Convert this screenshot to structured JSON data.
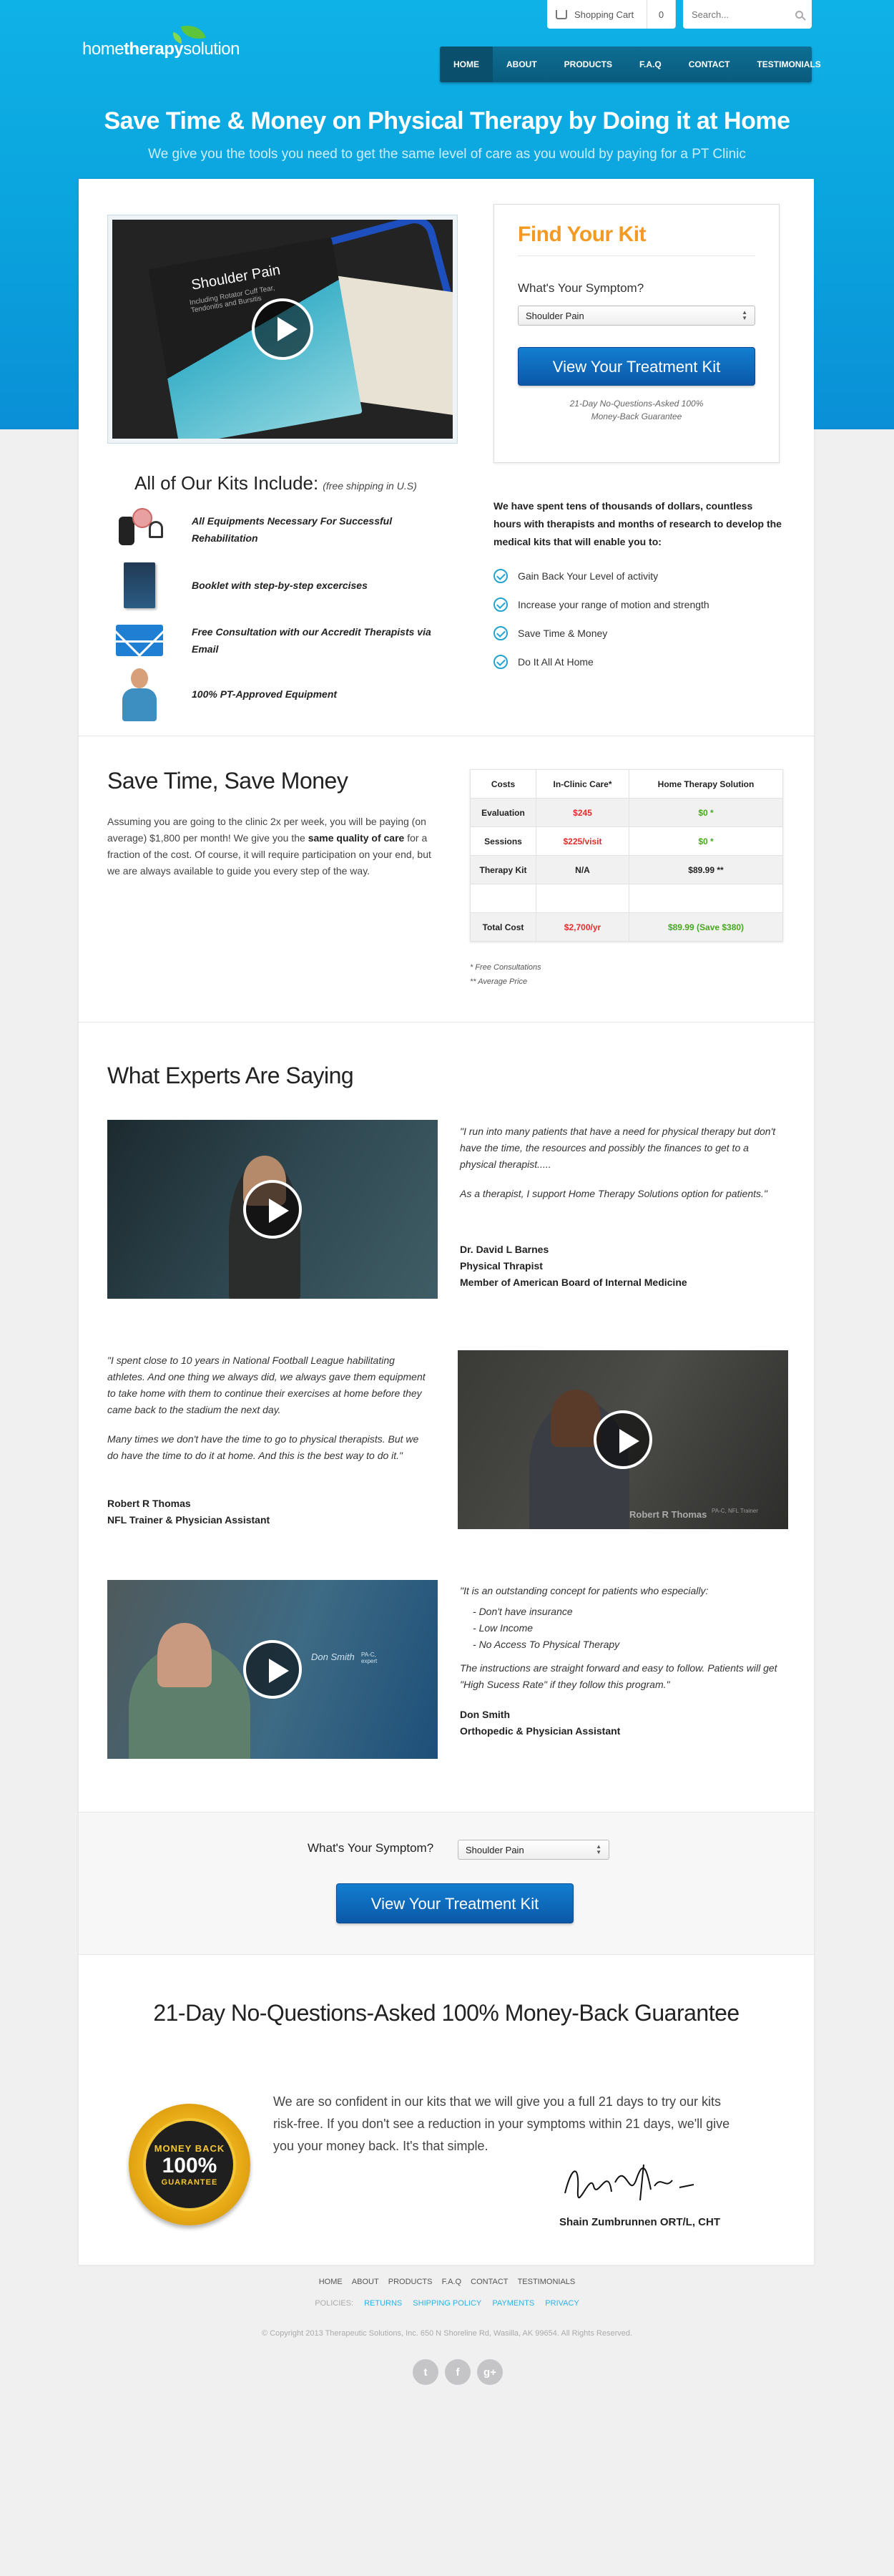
{
  "header": {
    "cart_label": "Shopping Cart",
    "cart_count": "0",
    "search_placeholder": "Search...",
    "logo": {
      "part1": "home",
      "part2": "therapy",
      "part3": "solution"
    },
    "nav": [
      "HOME",
      "ABOUT",
      "PRODUCTS",
      "F.A.Q",
      "CONTACT",
      "TESTIMONIALS"
    ]
  },
  "hero": {
    "title": "Save Time & Money on Physical Therapy by Doing it at Home",
    "subtitle": "We give you the tools you need to get the same level of care as you would by paying for a PT Clinic"
  },
  "product": {
    "folder_title": "Shoulder Pain",
    "folder_sub": "Including Rotator Cuff Tear, Tendonitis and Bursitis",
    "brand": "hometherapysolution"
  },
  "find_kit": {
    "title": "Find Your Kit",
    "symptom_label": "What's Your Symptom?",
    "symptom_value": "Shoulder Pain",
    "button": "View Your Treatment Kit",
    "guarantee": "21-Day No-Questions-Asked 100% Money-Back Guarantee"
  },
  "kits": {
    "title": "All of Our Kits Include:",
    "note": "(free shipping in U.S)",
    "items": [
      {
        "text": "All Equipments Necessary For Successful Rehabilitation",
        "icon": "equipment-icon"
      },
      {
        "text": "Booklet with step-by-step excercises",
        "icon": "booklet-icon"
      },
      {
        "text": "Free Consultation with our Accredit Therapists via Email",
        "icon": "email-icon"
      },
      {
        "text": "100% PT-Approved Equipment",
        "icon": "therapist-icon"
      }
    ]
  },
  "research": {
    "text": "We have spent tens of thousands of dollars, countless hours with therapists and months of research to develop the medical kits that will enable you to:",
    "benefits": [
      "Gain Back Your Level of activity",
      "Increase your range of motion and strength",
      "Save Time & Money",
      "Do It All At Home"
    ]
  },
  "savings": {
    "title": "Save Time, Save Money",
    "p1": "Assuming you are going to the clinic 2x per week, you will be paying (on average) $1,800 per month! We give you the ",
    "p_bold": "same quality of care",
    "p2": " for a fraction of the cost. Of course, it will require participation on your end, but we are always available to guide you every step of the way.",
    "table": {
      "headers": [
        "Costs",
        "In-Clinic Care*",
        "Home Therapy Solution"
      ],
      "rows": [
        [
          "Evaluation",
          "$245",
          "$0 *"
        ],
        [
          "Sessions",
          "$225/visit",
          "$0 *"
        ],
        [
          "Therapy Kit",
          "N/A",
          "$89.99 **"
        ],
        [
          "",
          "",
          ""
        ],
        [
          "Total Cost",
          "$2,700/yr",
          "$89.99 (Save $380)"
        ]
      ]
    },
    "note1": "* Free Consultations",
    "note2": "** Average Price"
  },
  "experts": {
    "title": "What Experts Are Saying",
    "e1": {
      "q1": "\"I run into many patients that have a need for physical therapy but don't have the time, the resources and possibly the finances to get to a physical therapist.....",
      "q2": "As a therapist, I support Home Therapy Solutions option for patients.\"",
      "name": "Dr. David L Barnes",
      "role1": "Physical Thrapist",
      "role2": "Member of American Board of Internal Medicine"
    },
    "e2": {
      "q1": "\"I spent close to 10 years in National Football League habilitating athletes. And one thing we always did, we always gave them equipment to take home with them to continue their exercises at home before they came back to the stadium the next day.",
      "q2": "Many times we don't have the time to go to physical therapists. But we do have the time to do it at home. And this is the best way to do it.\"",
      "name": "Robert R Thomas",
      "role1": "NFL Trainer & Physician Assistant",
      "caption": "Robert R Thomas",
      "caption2": "PA-C, NFL Trainer"
    },
    "e3": {
      "q1": "\"It is an outstanding concept for patients who especially:",
      "bullets": [
        "Don't have insurance",
        "Low Income",
        "No Access To Physical Therapy"
      ],
      "q2": "The instructions are straight forward and easy to follow. Patients will get \"High Sucess Rate\" if they follow this program.\"",
      "name": "Don Smith",
      "role1": "Orthopedic & Physician Assistant",
      "caption": "Don Smith",
      "caption2": "PA-C, expert"
    }
  },
  "cta": {
    "label": "What's Your Symptom?",
    "value": "Shoulder Pain",
    "button": "View Your Treatment Kit"
  },
  "guarantee": {
    "title": "21-Day No-Questions-Asked 100% Money-Back Guarantee",
    "badge_top": "MONEY BACK",
    "badge_mid": "100%",
    "badge_bottom": "GUARANTEE",
    "text": "We are so confident in our kits that we will give you a full 21 days to try our kits risk-free. If you don't see a reduction in your symptoms within 21 days, we'll give you your money back. It's that simple.",
    "signer": "Shain Zumbrunnen ORT/L, CHT"
  },
  "footer": {
    "links": [
      "HOME",
      "ABOUT",
      "PRODUCTS",
      "F.A.Q",
      "CONTACT",
      "TESTIMONIALS"
    ],
    "policies_label": "POLICIES:",
    "policies": [
      "RETURNS",
      "SHIPPING POLICY",
      "PAYMENTS",
      "PRIVACY"
    ],
    "copyright": "© Copyright 2013 Therapeutic Solutions, Inc. 650 N Shoreline Rd, Wasilla, AK 99654. All Rights Reserved.",
    "social": [
      "twitter-icon",
      "facebook-icon",
      "google-plus-icon"
    ]
  },
  "colors": {
    "accent_blue": "#0aa2dd",
    "orange": "#f39a25",
    "button_blue": "#0b58a8",
    "red": "#e42c2c",
    "green": "#47a820"
  }
}
